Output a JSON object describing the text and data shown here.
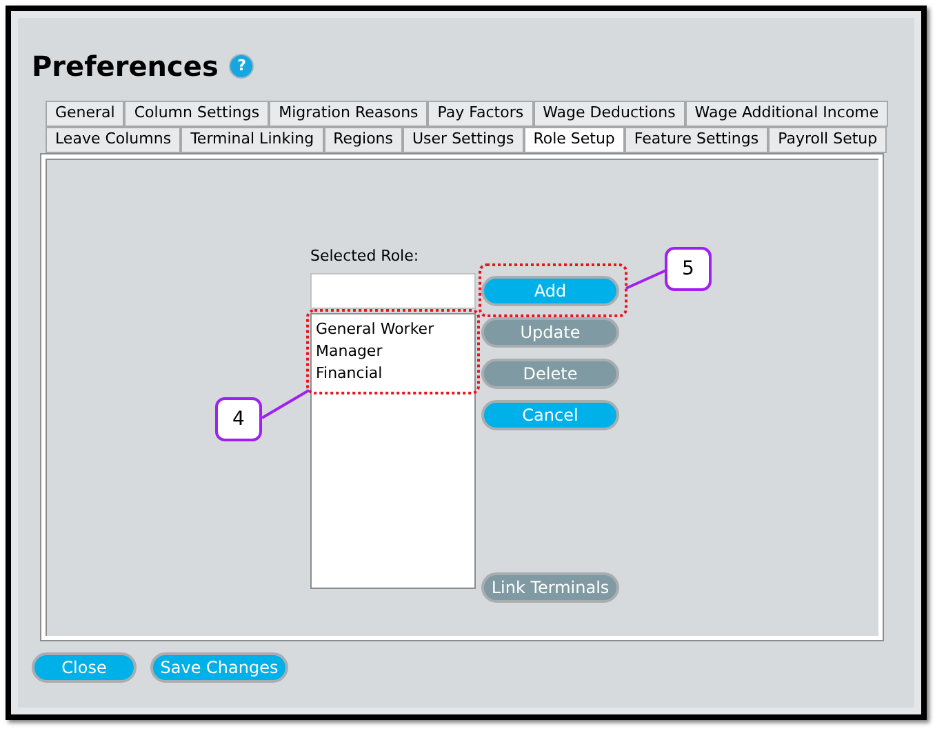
{
  "window": {
    "title": "Preferences",
    "help_button": "?"
  },
  "tab_rows": [
    [
      {
        "label": "General",
        "selected": false
      },
      {
        "label": "Column Settings",
        "selected": false
      },
      {
        "label": "Migration Reasons",
        "selected": false
      },
      {
        "label": "Pay Factors",
        "selected": false
      },
      {
        "label": "Wage Deductions",
        "selected": false
      },
      {
        "label": "Wage Additional Income",
        "selected": false
      }
    ],
    [
      {
        "label": "Leave Columns",
        "selected": false
      },
      {
        "label": "Terminal Linking",
        "selected": false
      },
      {
        "label": "Regions",
        "selected": false
      },
      {
        "label": "User Settings",
        "selected": false
      },
      {
        "label": "Role Setup",
        "selected": true
      },
      {
        "label": "Feature Settings",
        "selected": false
      },
      {
        "label": "Payroll Setup",
        "selected": false
      }
    ]
  ],
  "role_setup": {
    "label": "Selected Role:",
    "roles": [
      "General Worker",
      "Manager",
      "Financial"
    ],
    "buttons": [
      {
        "label": "Add",
        "disabled": false
      },
      {
        "label": "Update",
        "disabled": true
      },
      {
        "label": "Delete",
        "disabled": true
      },
      {
        "label": "Cancel",
        "disabled": false
      }
    ],
    "link_button": {
      "label": "Link Terminals",
      "disabled": true
    }
  },
  "footer_buttons": [
    {
      "label": "Close",
      "disabled": false
    },
    {
      "label": "Save Changes",
      "disabled": false
    }
  ],
  "callouts": [
    {
      "label": "4"
    },
    {
      "label": "5"
    }
  ]
}
